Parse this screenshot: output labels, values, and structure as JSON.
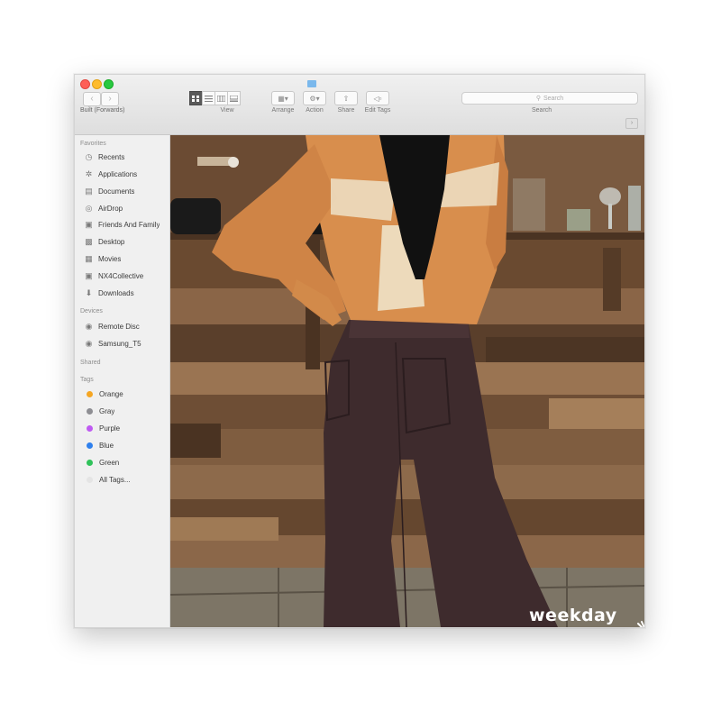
{
  "window": {
    "breadcrumb": "Built (Forwards)",
    "toolbar": {
      "view_label": "View",
      "arrange_label": "Arrange",
      "action_label": "Action",
      "share_label": "Share",
      "edit_tags_label": "Edit Tags",
      "search_placeholder": "Search",
      "search_label": "Search"
    }
  },
  "sidebar": {
    "favorites_header": "Favorites",
    "favorites": [
      {
        "label": "Recents",
        "icon": "clock-icon"
      },
      {
        "label": "Applications",
        "icon": "applications-icon"
      },
      {
        "label": "Documents",
        "icon": "documents-icon"
      },
      {
        "label": "AirDrop",
        "icon": "airdrop-icon"
      },
      {
        "label": "Friends And Family",
        "icon": "folder-icon"
      },
      {
        "label": "Desktop",
        "icon": "desktop-icon"
      },
      {
        "label": "Movies",
        "icon": "movies-icon"
      },
      {
        "label": "NX4Collective",
        "icon": "folder-icon"
      },
      {
        "label": "Downloads",
        "icon": "downloads-icon"
      }
    ],
    "devices_header": "Devices",
    "devices": [
      {
        "label": "Remote Disc",
        "icon": "disc-icon"
      },
      {
        "label": "Samsung_T5",
        "icon": "drive-icon"
      }
    ],
    "shared_header": "Shared",
    "tags_header": "Tags",
    "tags": [
      {
        "label": "Orange",
        "color": "#f5a623"
      },
      {
        "label": "Gray",
        "color": "#8e8e93"
      },
      {
        "label": "Purple",
        "color": "#bf5af2"
      },
      {
        "label": "Blue",
        "color": "#2f80ed"
      },
      {
        "label": "Green",
        "color": "#30c25a"
      },
      {
        "label": "All Tags...",
        "color": "#e4e4e4"
      }
    ]
  },
  "photo": {
    "brand_text": "weekday"
  },
  "colors": {
    "wood_dark": "#4a3322",
    "wood_mid": "#7a5738",
    "wood_light": "#9c7552",
    "top": "#d88e4d",
    "lace": "#efe2c8",
    "jeans": "#3e2b2d",
    "hair": "#111111"
  }
}
